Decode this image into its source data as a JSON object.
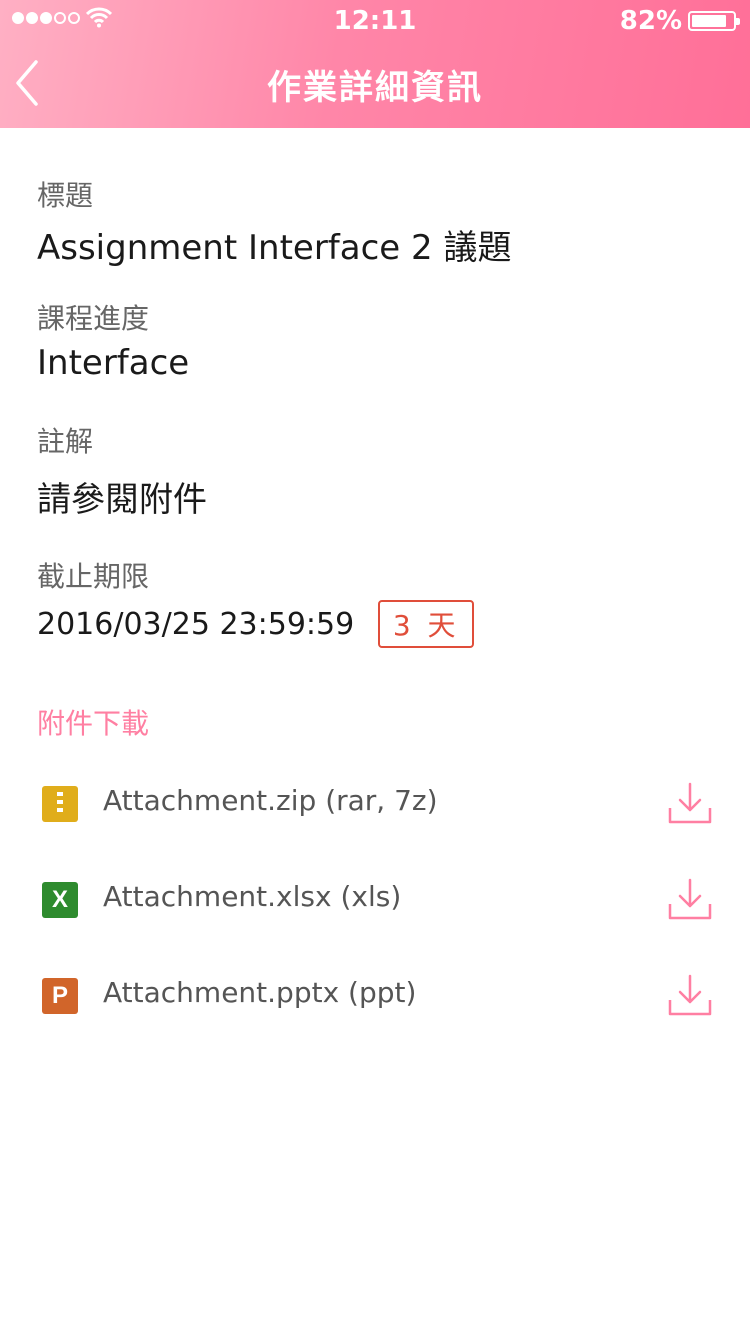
{
  "status_bar": {
    "time": "12:11",
    "battery": "82%"
  },
  "nav": {
    "title": "作業詳細資訊"
  },
  "fields": {
    "title_label": "標題",
    "title_value": "Assignment Interface 2 議題",
    "progress_label": "課程進度",
    "progress_value": "Interface",
    "note_label": "註解",
    "note_value": "請參閱附件",
    "deadline_label": "截止期限",
    "deadline_value": "2016/03/25 23:59:59",
    "days_left": "3 天"
  },
  "attachments": {
    "section_title": "附件下載",
    "items": [
      {
        "icon": "zip-file-icon",
        "glyph": "",
        "name": "Attachment.zip (rar, 7z)"
      },
      {
        "icon": "excel-file-icon",
        "glyph": "X",
        "name": "Attachment.xlsx (xls)"
      },
      {
        "icon": "powerpoint-file-icon",
        "glyph": "P",
        "name": "Attachment.pptx (ppt)"
      }
    ]
  },
  "colors": {
    "accent": "#ff7fa2",
    "deadline": "#e04e3a",
    "zip": "#e0ad1b",
    "xlsx": "#2e8b2e",
    "pptx": "#d1652a"
  }
}
